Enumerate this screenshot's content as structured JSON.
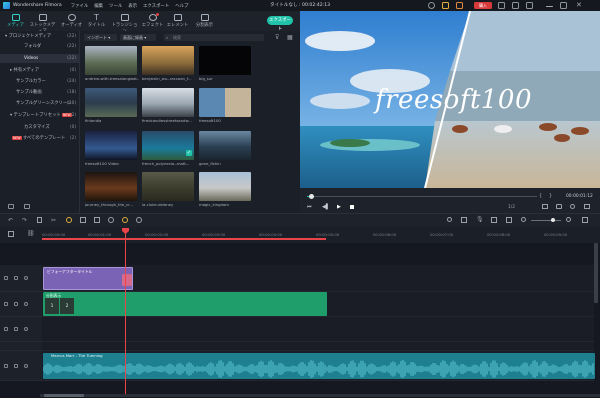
{
  "titlebar": {
    "app": "Wondershare Filmora",
    "menu": [
      "ファイル",
      "編集",
      "ツール",
      "表示",
      "エクスポート",
      "ヘルプ"
    ],
    "title": "タイトルなし : 00:02:42:13",
    "buy": "購入"
  },
  "toolbar": {
    "tools": [
      "メディア",
      "ストックメディア",
      "オーディオ",
      "タイトル",
      "トランジション",
      "エフェクト",
      "エレメント",
      "分割表示"
    ],
    "export": "エクスポート"
  },
  "sidebar": {
    "items": [
      {
        "label": "プロジェクトメディア",
        "count": "(22)"
      },
      {
        "label": "フォルダ",
        "count": "(22)"
      },
      {
        "label": "Videos",
        "count": "(22)"
      },
      {
        "label": "共有メディア",
        "count": "(0)"
      },
      {
        "label": "サンプルカラー",
        "count": "(24)"
      },
      {
        "label": "サンプル動画",
        "count": "(18)"
      },
      {
        "label": "サンプルグリーンスクリーン",
        "count": "(10)"
      },
      {
        "label": "テンプレートプリセット",
        "count": "(2)"
      },
      {
        "label": "カスタマイズ",
        "count": "(0)"
      },
      {
        "label": "すべてのテンプレート",
        "count": "(2)"
      }
    ],
    "new_badge": "NEW"
  },
  "media": {
    "import": "インポート",
    "record": "画面に録画",
    "search_placeholder": "検索",
    "clips": [
      "andrew-with-treesalongwat...",
      "benjamin_wu--raccoon_f...",
      "big_sur",
      "finlandia",
      "firedcandiesstreetsandw...",
      "freesoft100",
      "freesoft100 Video",
      "french_polynesia--matt...",
      "gone_fishin",
      "journey_through_the_cr...",
      "la-cluke-delaney",
      "magic_kingdom"
    ]
  },
  "preview": {
    "watermark": "freesoft100",
    "timecode": "00:00:01:12",
    "zoom": "1/2",
    "progress": 0.03
  },
  "timeline": {
    "ruler": [
      "00:00:00:00",
      "00:00:01:00",
      "00:00:02:00",
      "00:00:03:00",
      "00:00:04:00",
      "00:00:05:00",
      "00:00:06:00",
      "00:00:07:00",
      "00:00:08:00",
      "00:00:09:00",
      "00:00:10:00"
    ],
    "title_clip": "ビフォーアフタータイトル",
    "video_clip": "分割表示",
    "video_nums": [
      "1",
      "2"
    ],
    "audio_clip": "Marcus Marr - The Tumning"
  },
  "colors": {
    "accent": "#20c2aa",
    "playhead": "#e8454a",
    "title_clip": "#7a63b4",
    "video_clip": "#1f9d6a",
    "audio_clip": "#1e7f8e"
  }
}
